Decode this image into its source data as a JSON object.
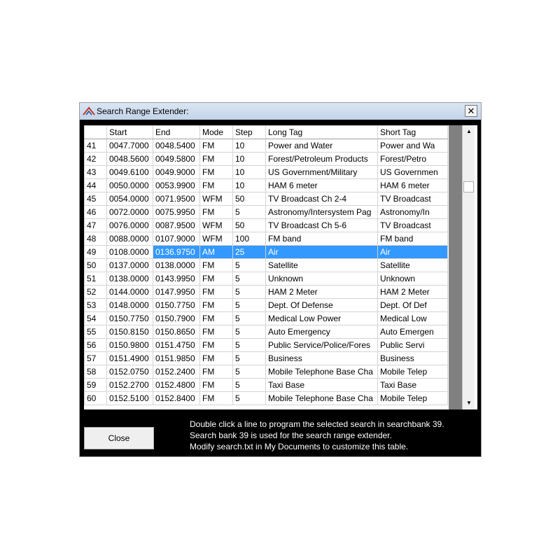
{
  "window": {
    "title": "Search Range Extender:"
  },
  "table": {
    "headers": [
      "Start",
      "End",
      "Mode",
      "Step",
      "Long Tag",
      "Short Tag"
    ],
    "rows": [
      {
        "n": "41",
        "start": "0047.7000",
        "end": "0048.5400",
        "mode": "FM",
        "step": "10",
        "long": "Power and Water",
        "short": "Power and Wa"
      },
      {
        "n": "42",
        "start": "0048.5600",
        "end": "0049.5800",
        "mode": "FM",
        "step": "10",
        "long": "Forest/Petroleum Products",
        "short": "Forest/Petro"
      },
      {
        "n": "43",
        "start": "0049.6100",
        "end": "0049.9000",
        "mode": "FM",
        "step": "10",
        "long": "US Government/Military",
        "short": "US Governmen"
      },
      {
        "n": "44",
        "start": "0050.0000",
        "end": "0053.9900",
        "mode": "FM",
        "step": "10",
        "long": "HAM 6 meter",
        "short": "HAM 6 meter"
      },
      {
        "n": "45",
        "start": "0054.0000",
        "end": "0071.9500",
        "mode": "WFM",
        "step": "50",
        "long": "TV Broadcast Ch 2-4",
        "short": "TV Broadcast"
      },
      {
        "n": "46",
        "start": "0072.0000",
        "end": "0075.9950",
        "mode": "FM",
        "step": "5",
        "long": "Astronomy/Intersystem Pag",
        "short": "Astronomy/In"
      },
      {
        "n": "47",
        "start": "0076.0000",
        "end": "0087.9500",
        "mode": "WFM",
        "step": "50",
        "long": "TV Broadcast Ch 5-6",
        "short": "TV Broadcast"
      },
      {
        "n": "48",
        "start": "0088.0000",
        "end": "0107.9000",
        "mode": "WFM",
        "step": "100",
        "long": "FM band",
        "short": "FM band"
      },
      {
        "n": "49",
        "start": "0108.0000",
        "end": "0136.9750",
        "mode": "AM",
        "step": "25",
        "long": "Air",
        "short": "Air",
        "selected": true
      },
      {
        "n": "50",
        "start": "0137.0000",
        "end": "0138.0000",
        "mode": "FM",
        "step": "5",
        "long": "Satellite",
        "short": "Satellite"
      },
      {
        "n": "51",
        "start": "0138.0000",
        "end": "0143.9950",
        "mode": "FM",
        "step": "5",
        "long": "Unknown",
        "short": "Unknown"
      },
      {
        "n": "52",
        "start": "0144.0000",
        "end": "0147.9950",
        "mode": "FM",
        "step": "5",
        "long": "HAM 2 Meter",
        "short": "HAM 2 Meter"
      },
      {
        "n": "53",
        "start": "0148.0000",
        "end": "0150.7750",
        "mode": "FM",
        "step": "5",
        "long": "Dept. Of Defense",
        "short": "Dept. Of Def"
      },
      {
        "n": "54",
        "start": "0150.7750",
        "end": "0150.7900",
        "mode": "FM",
        "step": "5",
        "long": "Medical Low Power",
        "short": "Medical Low"
      },
      {
        "n": "55",
        "start": "0150.8150",
        "end": "0150.8650",
        "mode": "FM",
        "step": "5",
        "long": "Auto Emergency",
        "short": "Auto Emergen"
      },
      {
        "n": "56",
        "start": "0150.9800",
        "end": "0151.4750",
        "mode": "FM",
        "step": "5",
        "long": "Public Service/Police/Fores",
        "short": "Public Servi"
      },
      {
        "n": "57",
        "start": "0151.4900",
        "end": "0151.9850",
        "mode": "FM",
        "step": "5",
        "long": "Business",
        "short": "Business"
      },
      {
        "n": "58",
        "start": "0152.0750",
        "end": "0152.2400",
        "mode": "FM",
        "step": "5",
        "long": "Mobile Telephone Base Cha",
        "short": "Mobile Telep"
      },
      {
        "n": "59",
        "start": "0152.2700",
        "end": "0152.4800",
        "mode": "FM",
        "step": "5",
        "long": "Taxi Base",
        "short": "Taxi Base"
      },
      {
        "n": "60",
        "start": "0152.5100",
        "end": "0152.8400",
        "mode": "FM",
        "step": "5",
        "long": "Mobile Telephone Base Cha",
        "short": "Mobile Telep"
      }
    ]
  },
  "buttons": {
    "close": "Close"
  },
  "info": {
    "line1": "Double click a line to program the selected search in searchbank 39.",
    "line2": "Search bank 39 is used for the search range extender.",
    "line3": "Modify search.txt in My Documents to customize this table."
  },
  "colors": {
    "selection": "#3399ff",
    "window_bg": "#000000",
    "title_bar": "#c3d3e8"
  },
  "icons": {
    "app": "app-logo-icon",
    "close": "close-icon",
    "scroll_up": "scroll-up-icon",
    "scroll_down": "scroll-down-icon"
  }
}
